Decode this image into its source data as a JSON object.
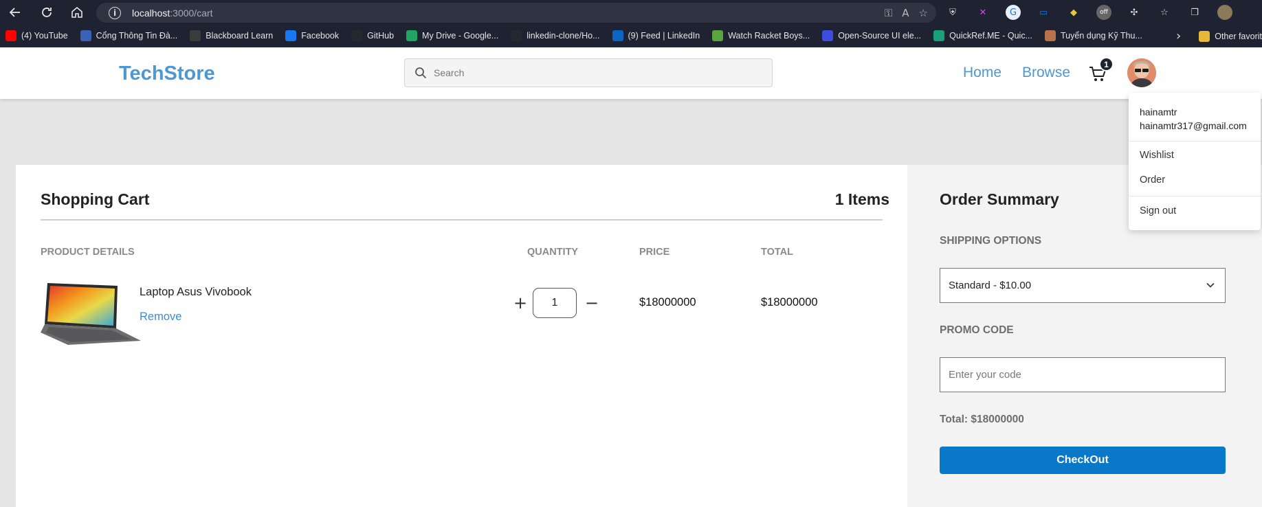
{
  "browser": {
    "url_host": "localhost",
    "url_path": ":3000/cart",
    "bookmarks": [
      {
        "label": "(4) YouTube",
        "icon": "youtube-icon",
        "color": "#ff0000"
      },
      {
        "label": "Cổng Thông Tin Đà...",
        "icon": "university-icon",
        "color": "#3a63b8"
      },
      {
        "label": "Blackboard Learn",
        "icon": "blackboard-icon",
        "color": "#3b3b3b"
      },
      {
        "label": "Facebook",
        "icon": "facebook-icon",
        "color": "#1877f2"
      },
      {
        "label": "GitHub",
        "icon": "github-icon",
        "color": "#24292f"
      },
      {
        "label": "My Drive - Google...",
        "icon": "google-drive-icon",
        "color": "#1fa463"
      },
      {
        "label": "linkedin-clone/Ho...",
        "icon": "github-icon",
        "color": "#24292f"
      },
      {
        "label": "(9) Feed | LinkedIn",
        "icon": "linkedin-icon",
        "color": "#0a66c2"
      },
      {
        "label": "Watch Racket Boys...",
        "icon": "play-icon",
        "color": "#5aa53d"
      },
      {
        "label": "Open-Source UI ele...",
        "icon": "ui-icon",
        "color": "#3b4ee0"
      },
      {
        "label": "QuickRef.ME - Quic...",
        "icon": "quickref-icon",
        "color": "#1a9f7a"
      },
      {
        "label": "Tuyển dụng Kỹ Thu...",
        "icon": "jobs-icon",
        "color": "#b8734c"
      }
    ],
    "other_favorites": "Other favorit"
  },
  "header": {
    "logo": "TechStore",
    "search_placeholder": "Search",
    "nav_home": "Home",
    "nav_browse": "Browse",
    "cart_count": "1"
  },
  "cart": {
    "title": "Shopping Cart",
    "item_count": "1 Items",
    "columns": {
      "product": "PRODUCT DETAILS",
      "quantity": "QUANTITY",
      "price": "PRICE",
      "total": "TOTAL"
    },
    "items": [
      {
        "name": "Laptop Asus Vivobook",
        "remove_label": "Remove",
        "quantity": "1",
        "price": "$18000000",
        "total": "$18000000"
      }
    ]
  },
  "summary": {
    "title": "Order Summary",
    "shipping_label": "SHIPPING OPTIONS",
    "shipping_value": "Standard - $10.00",
    "promo_label": "PROMO CODE",
    "promo_placeholder": "Enter your code",
    "total": "Total: $18000000",
    "checkout_label": "CheckOut"
  },
  "user_menu": {
    "username": "hainamtr",
    "email": "hainamtr317@gmail.com",
    "items": [
      "Wishlist",
      "Order",
      "Sign out"
    ]
  },
  "colors": {
    "brand": "#4d97d3",
    "checkout": "#0a78c8",
    "browser_bg": "#1f2230"
  }
}
